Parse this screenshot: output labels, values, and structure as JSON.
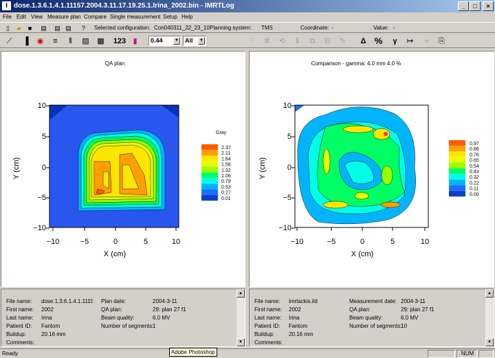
{
  "window": {
    "title": "dose.1.3.6.1.4.1.11157.2004.3.11.17.19.25.1.Irina_2002.bin - IMRTLog",
    "icon_letter": "I",
    "minimize": "_",
    "maximize": "□",
    "close": "×"
  },
  "menu": [
    "File",
    "Edit",
    "View",
    "Measure plan",
    "Compare",
    "Single measurement",
    "Setup",
    "Help"
  ],
  "toolbar": {
    "selected_configuration_label": "Selected configuration:",
    "selected_configuration_value": "Con040311_22_23_10",
    "planning_system_label": "Planning system:",
    "planning_system_value": "TMS",
    "coordinate_label": "Coordinate:",
    "coordinate_value": "-",
    "value_label": "Value:",
    "value_value": "-",
    "zoom_value": "0.44",
    "all_value": "All",
    "numbers_icon": "123",
    "delta_icon": "Δ",
    "percent_icon": "%",
    "gamma_icon": "γ"
  },
  "left_plot": {
    "title": "QA plan",
    "colorbar_title": "Gray",
    "colorbar_ticks": [
      "2.37",
      "2.11",
      "1.84",
      "1.58",
      "1.32",
      "1.06",
      "0.79",
      "0.53",
      "0.27",
      "0.01"
    ],
    "xlabel": "X (cm)",
    "ylabel": "Y (cm)",
    "x_ticks": [
      "−10",
      "−5",
      "0",
      "5",
      "10"
    ],
    "y_ticks": [
      "10",
      "5",
      "0",
      "−5",
      "−10"
    ]
  },
  "right_plot": {
    "title": "Comparison - gamma: 4.0 mm 4.0 %",
    "colorbar_ticks": [
      "0.97",
      "0.86",
      "0.76",
      "0.65",
      "0.54",
      "0.43",
      "0.32",
      "0.22",
      "0.11",
      "0.00"
    ],
    "xlabel": "X (cm)",
    "ylabel": "Y (cm)",
    "x_ticks": [
      "−10",
      "−5",
      "0",
      "5",
      "10"
    ],
    "y_ticks": [
      "10",
      "5",
      "0",
      "−5",
      "−10"
    ]
  },
  "chart_data": [
    {
      "type": "heatmap",
      "title": "QA plan",
      "xlabel": "X (cm)",
      "ylabel": "Y (cm)",
      "xlim": [
        -12,
        12
      ],
      "ylim": [
        -10,
        10
      ],
      "legend_title": "Gray",
      "levels": [
        0.01,
        0.27,
        0.53,
        0.79,
        1.06,
        1.32,
        1.58,
        1.84,
        2.11,
        2.37
      ]
    },
    {
      "type": "heatmap",
      "title": "Comparison - gamma: 4.0 mm 4.0 %",
      "xlabel": "X (cm)",
      "ylabel": "Y (cm)",
      "xlim": [
        -12,
        12
      ],
      "ylim": [
        -10,
        10
      ],
      "levels": [
        0.0,
        0.11,
        0.22,
        0.32,
        0.43,
        0.54,
        0.65,
        0.76,
        0.86,
        0.97
      ]
    }
  ],
  "left_info": {
    "rows": [
      {
        "l1": "File name:",
        "v1": "dose.1.3.6.1.4.1.1115:",
        "l2": "Plan date:",
        "v2": "2004-3-11"
      },
      {
        "l1": "First name:",
        "v1": "2002",
        "l2": "QA plan:",
        "v2": "29: plan 27 f1"
      },
      {
        "l1": "Last name:",
        "v1": "Irina",
        "l2": "Beam quality:",
        "v2": "6.0 MV"
      },
      {
        "l1": "Patient ID:",
        "v1": "Fantom",
        "l2": "Number of segments:",
        "v2": "1"
      },
      {
        "l1": "Buildup:",
        "v1": "20.16 mm",
        "l2": "",
        "v2": ""
      },
      {
        "l1": "Comments:",
        "v1": "",
        "l2": "",
        "v2": ""
      }
    ]
  },
  "right_info": {
    "rows": [
      {
        "l1": "File name:",
        "v1": "imrtackis.ild",
        "l2": "Measurement date:",
        "v2": "2004-3-11"
      },
      {
        "l1": "First name:",
        "v1": "2002",
        "l2": "QA plan:",
        "v2": "29: plan 27 f1"
      },
      {
        "l1": "Last name:",
        "v1": "Irina",
        "l2": "Beam quality:",
        "v2": "6.0 MV"
      },
      {
        "l1": "Patient ID:",
        "v1": "Fantom",
        "l2": "Number of segments:",
        "v2": "10"
      },
      {
        "l1": "Buildup:",
        "v1": "20.16 mm",
        "l2": "",
        "v2": ""
      },
      {
        "l1": "Comments:",
        "v1": "",
        "l2": "",
        "v2": ""
      }
    ]
  },
  "status": {
    "text": "Ready",
    "num": "NUM",
    "tooltip": "Adobe Photoshop"
  },
  "colors": {
    "c0": "#0a41c8",
    "c1": "#1e6eff",
    "c2": "#00b4ff",
    "c3": "#00ffe6",
    "c4": "#00ff64",
    "c5": "#96ff00",
    "c6": "#e6ff00",
    "c7": "#ffe600",
    "c8": "#ffa000",
    "c9": "#ff5a00",
    "bg": "#2a56f0",
    "hi": "#ff2d00"
  }
}
